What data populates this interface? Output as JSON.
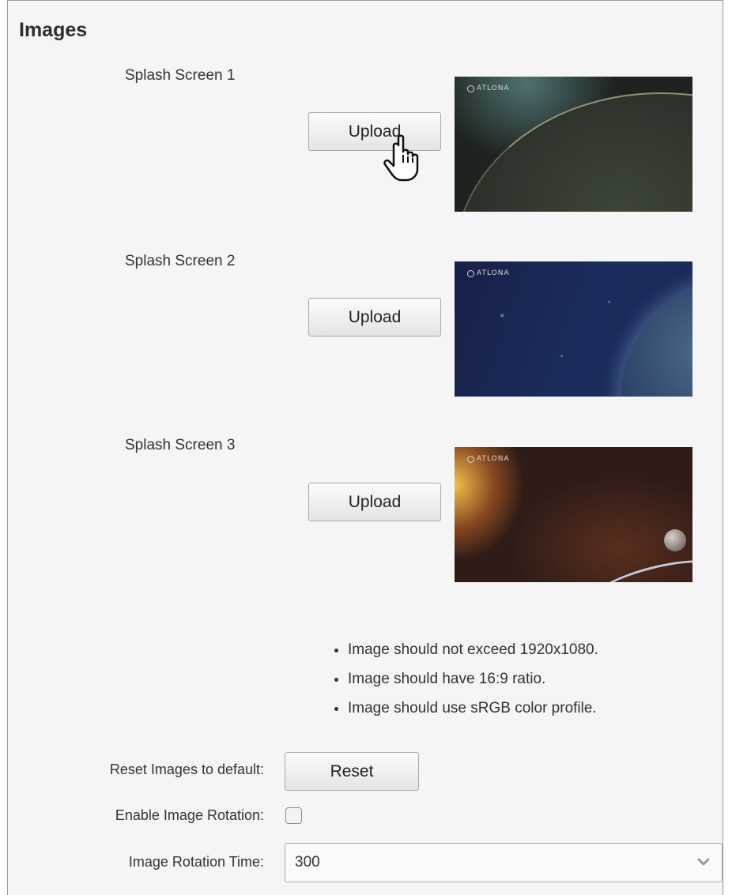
{
  "section": {
    "title": "Images"
  },
  "splash_screens": [
    {
      "label": "Splash Screen 1",
      "button": "Upload",
      "logo_text": "ATLONA"
    },
    {
      "label": "Splash Screen 2",
      "button": "Upload",
      "logo_text": "ATLONA"
    },
    {
      "label": "Splash Screen 3",
      "button": "Upload",
      "logo_text": "ATLONA"
    }
  ],
  "notes": [
    "Image should not exceed 1920x1080.",
    "Image should have 16:9 ratio.",
    "Image should use sRGB color profile."
  ],
  "reset": {
    "label": "Reset Images to default:",
    "button": "Reset"
  },
  "rotation": {
    "label": "Enable Image Rotation:",
    "checked": false
  },
  "rotation_time": {
    "label": "Image Rotation Time:",
    "value": "300"
  },
  "icons": {
    "cursor": "hand-pointer-icon",
    "dropdown": "chevron-down-icon",
    "logo": "atlona-logo-icon"
  }
}
